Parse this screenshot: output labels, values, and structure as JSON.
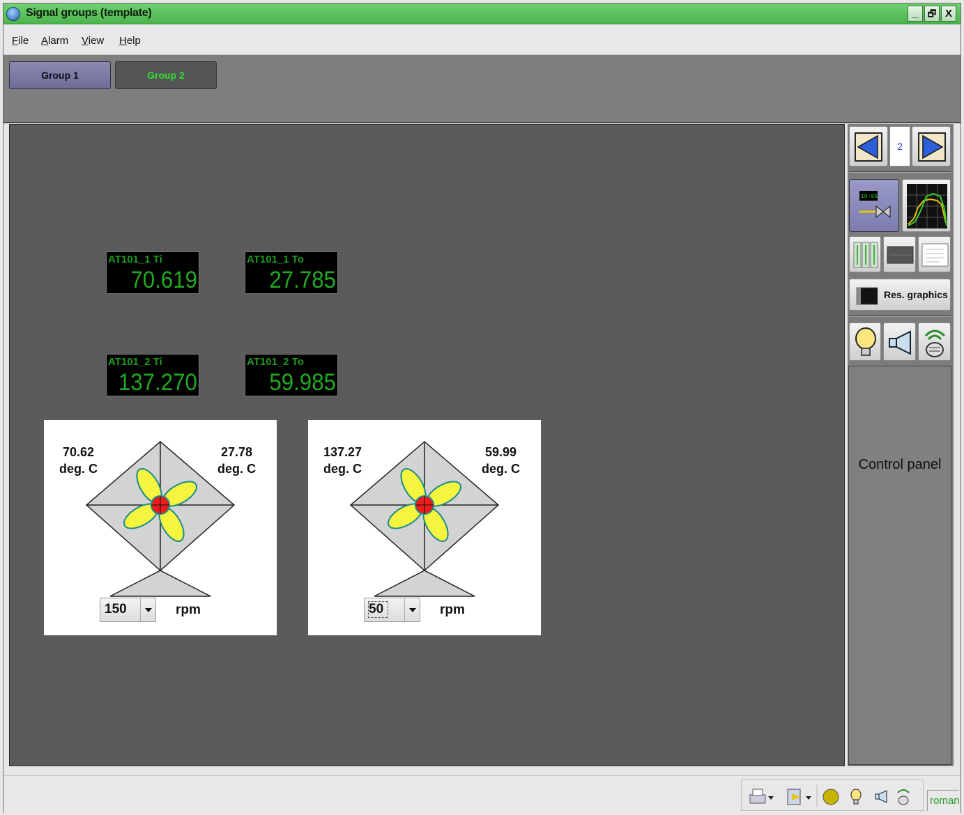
{
  "window": {
    "title": "Signal groups (template)",
    "min_label": "_",
    "max_label": "🗗",
    "close_label": "X"
  },
  "menu": [
    {
      "key": "F",
      "rest": "ile"
    },
    {
      "key": "A",
      "rest": "larm"
    },
    {
      "key": "V",
      "rest": "iew"
    },
    {
      "key": "H",
      "rest": "elp"
    }
  ],
  "tabs": [
    {
      "label": "Group 1"
    },
    {
      "label": "Group 2"
    }
  ],
  "displays": [
    {
      "tag": "AT101_1 Ti",
      "value": "70.619"
    },
    {
      "tag": "AT101_1 To",
      "value": "27.785"
    },
    {
      "tag": "AT101_2 Ti",
      "value": "137.270"
    },
    {
      "tag": "AT101_2 To",
      "value": "59.985"
    }
  ],
  "fans": [
    {
      "in_value": "70.62",
      "in_unit": "deg. C",
      "out_value": "27.78",
      "out_unit": "deg. C",
      "rpm_value": "150",
      "rpm_label": "rpm"
    },
    {
      "in_value": "137.27",
      "in_unit": "deg. C",
      "out_value": "59.99",
      "out_unit": "deg. C",
      "rpm_value": "50",
      "rpm_label": "rpm"
    }
  ],
  "side": {
    "page_number": "2",
    "res_graphics_label": "Res. graphics",
    "trend_display_time": "10:95",
    "control_panel_label": "Control panel"
  },
  "status": {
    "user": "roman"
  },
  "colors": {
    "title_green": "#4cb34c",
    "digit_green": "#22a922",
    "fan_blade": "#f5f540",
    "fan_hub": "#ee1c1c",
    "canvas": "#5b5b5b"
  }
}
